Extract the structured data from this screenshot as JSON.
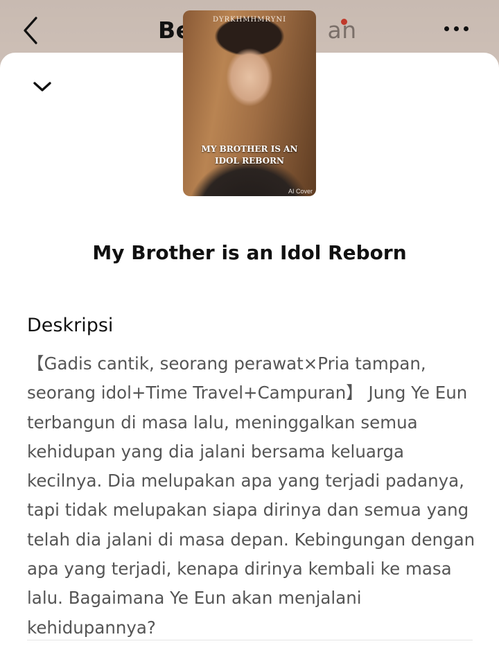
{
  "header": {
    "title_visible": "Be",
    "title_faded": "an",
    "back_icon": "chevron-left-icon",
    "more_icon": "more-horizontal-icon",
    "notification_color": "#c0392b"
  },
  "sheet": {
    "collapse_icon": "chevron-down-icon",
    "cover": {
      "author": "DYRKHMHMRYNI",
      "title": "My Brother is an Idol Reborn",
      "badge": "AI Cover"
    },
    "book_title": "My Brother is an Idol Reborn",
    "description_heading": "Deskripsi",
    "description": "【Gadis cantik, seorang perawat×Pria tampan, seorang idol+Time Travel+Campuran】 Jung Ye Eun terbangun di masa lalu, meninggalkan semua kehidupan yang dia jalani bersama keluarga kecilnya. Dia melupakan apa yang terjadi padanya, tapi tidak melupakan siapa dirinya dan semua yang telah dia jalani di masa depan. Kebingungan dengan apa yang terjadi, kenapa dirinya kembali ke masa lalu. Bagaimana Ye Eun akan menjalani kehidupannya?"
  }
}
